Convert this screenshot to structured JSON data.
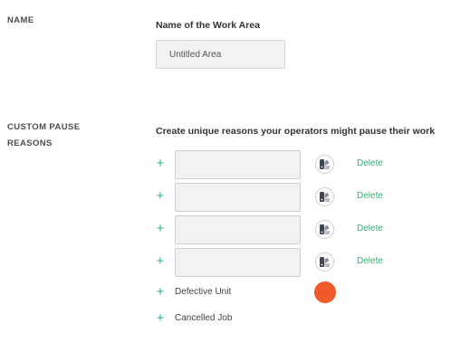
{
  "name_section": {
    "label": "NAME",
    "heading": "Name of the Work Area",
    "input_value": "Untitled Area"
  },
  "pause_section": {
    "label_line1": "CUSTOM PAUSE",
    "label_line2": "REASONS",
    "heading": "Create unique reasons your operators might pause their work",
    "editable_rows": [
      {
        "value": "",
        "delete_label": "Delete",
        "icon": "color-palette-icon"
      },
      {
        "value": "",
        "delete_label": "Delete",
        "icon": "color-palette-icon"
      },
      {
        "value": "",
        "delete_label": "Delete",
        "icon": "color-palette-icon"
      },
      {
        "value": "",
        "delete_label": "Delete",
        "icon": "color-palette-icon"
      }
    ],
    "preset_rows": [
      {
        "label": "Defective Unit"
      },
      {
        "label": "Cancelled Job"
      }
    ],
    "plus_glyph": "+"
  },
  "colors": {
    "accent_green": "#2bb673",
    "selected_color": "#f05a28"
  }
}
